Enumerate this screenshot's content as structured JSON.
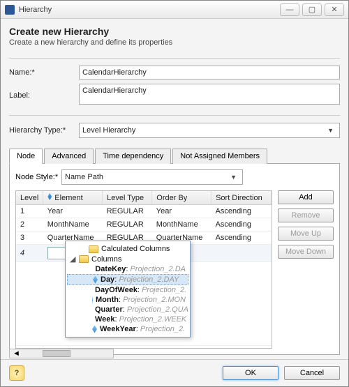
{
  "window": {
    "title": "Hierarchy"
  },
  "header": {
    "title": "Create new Hierarchy",
    "subtitle": "Create a new hierarchy and define its properties"
  },
  "form": {
    "name_label": "Name:*",
    "name_value": "CalendarHierarchy",
    "label_label": "Label:",
    "label_value": "CalendarHierarchy",
    "type_label": "Hierarchy Type:*",
    "type_value": "Level Hierarchy"
  },
  "tabs": {
    "items": [
      "Node",
      "Advanced",
      "Time dependency",
      "Not Assigned Members"
    ],
    "active": 0
  },
  "node_tab": {
    "style_label": "Node Style:*",
    "style_value": "Name Path",
    "columns": [
      "Level",
      "Element",
      "Level Type",
      "Order By",
      "Sort Direction"
    ],
    "rows": [
      {
        "level": "1",
        "element": "Year",
        "type": "REGULAR",
        "orderby": "Year",
        "sort": "Ascending"
      },
      {
        "level": "2",
        "element": "MonthName",
        "type": "REGULAR",
        "orderby": "MonthName",
        "sort": "Ascending"
      },
      {
        "level": "3",
        "element": "QuarterName",
        "type": "REGULAR",
        "orderby": "QuarterName",
        "sort": "Ascending"
      },
      {
        "level": "4",
        "element": "",
        "type": "",
        "orderby": "",
        "sort": ""
      }
    ],
    "buttons": {
      "add": "Add",
      "remove": "Remove",
      "moveup": "Move Up",
      "movedown": "Move Down"
    }
  },
  "popup": {
    "groups": [
      {
        "label": "Calculated Columns"
      },
      {
        "label": "Columns"
      }
    ],
    "columns": [
      {
        "name": "DateKey",
        "proj": "Projection_2.DA"
      },
      {
        "name": "Day",
        "proj": "Projection_2.DAY"
      },
      {
        "name": "DayOfWeek",
        "proj": "Projection_2."
      },
      {
        "name": "Month",
        "proj": "Projection_2.MON"
      },
      {
        "name": "Quarter",
        "proj": "Projection_2.QUA"
      },
      {
        "name": "Week",
        "proj": "Projection_2.WEEK"
      },
      {
        "name": "WeekYear",
        "proj": "Projection_2."
      }
    ],
    "selected_index": 1
  },
  "footer": {
    "ok": "OK",
    "cancel": "Cancel"
  }
}
